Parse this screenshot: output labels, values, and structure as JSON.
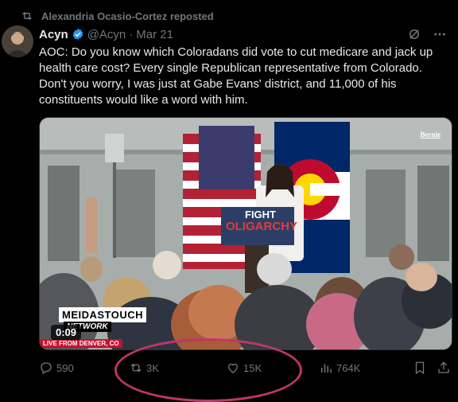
{
  "repost": {
    "text": "Alexandria Ocasio-Cortez reposted",
    "icon": "repost-icon"
  },
  "author": {
    "name": "Acyn",
    "handle": "@Acyn",
    "date": "Mar 21",
    "verified": true,
    "verified_color": "#1d9bf0"
  },
  "tweet": {
    "text": "AOC: Do you know which Coloradans did vote to cut medicare and jack up health care cost? Every single Republican representative from Colorado. Don't you worry, I was just at Gabe Evans' district, and 11,000 of his constituents would like a word with him."
  },
  "media": {
    "watermark": "Bernie",
    "sign_line1": "FIGHT",
    "sign_line2": "OLIGARCHY",
    "brand": "MEIDASTOUCH",
    "network": "NETWORK",
    "live": "LIVE FROM DENVER, CO",
    "duration": "0:09"
  },
  "actions": {
    "replies": "590",
    "reposts": "3K",
    "likes": "15K",
    "views": "764K"
  },
  "colors": {
    "background": "#000000",
    "muted": "#71767b",
    "text": "#e7e9ea",
    "highlight": "#c1356a"
  }
}
